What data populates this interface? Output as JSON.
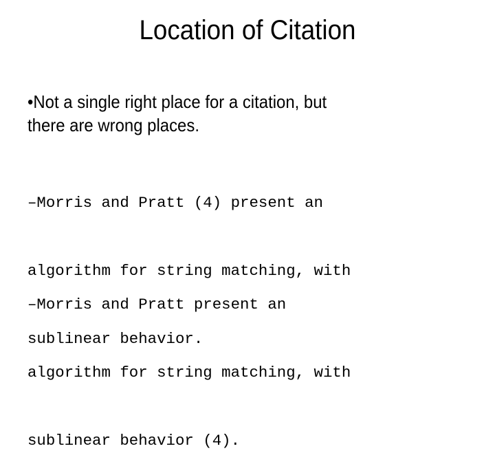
{
  "slide": {
    "title": "Location of Citation",
    "bullet": "•Not a single right place for a citation, but there are wrong places.",
    "bullet_lines": [
      "•Not a single right place for a citation, but",
      "there are wrong places."
    ],
    "sub_bullets": [
      {
        "lines": [
          "–Morris and Pratt (4) present an",
          "algorithm for string matching, with",
          "sublinear behavior."
        ]
      },
      {
        "lines": [
          "–Morris and Pratt present an",
          "algorithm for string matching, with",
          "sublinear behavior (4)."
        ]
      }
    ]
  }
}
